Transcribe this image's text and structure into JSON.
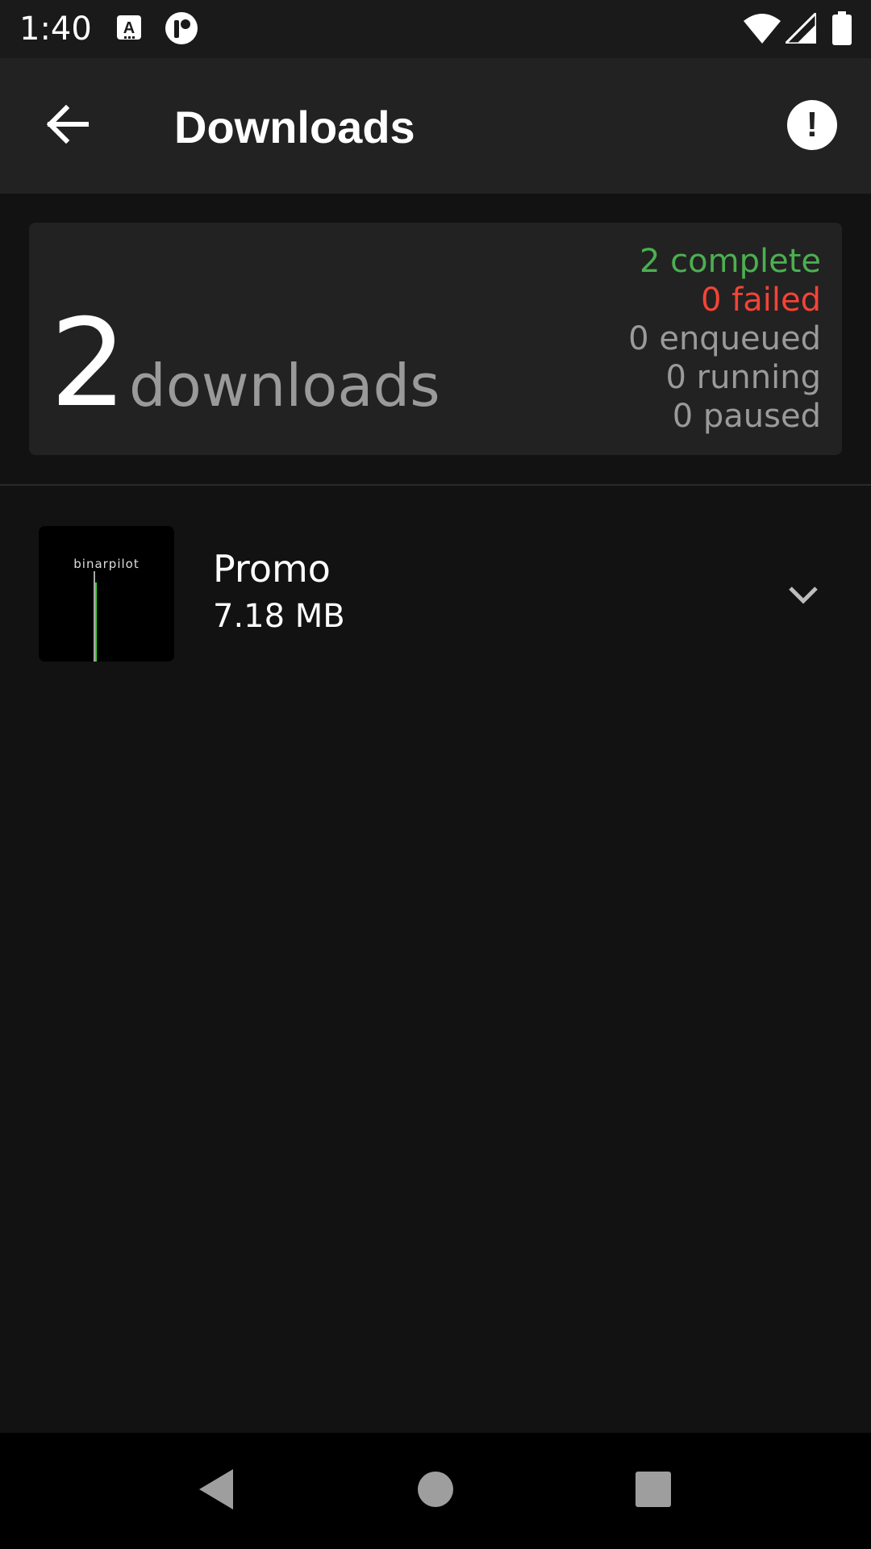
{
  "status_bar": {
    "time": "1:40",
    "left_icons": [
      "keyboard-a-icon",
      "circle-r-icon"
    ],
    "right_icons": [
      "wifi-icon",
      "signal-icon",
      "battery-icon"
    ]
  },
  "app_bar": {
    "back_icon": "arrow-left-icon",
    "title": "Downloads",
    "action_icon": "alert-info-icon",
    "action_symbol": "!"
  },
  "summary": {
    "count": "2",
    "label": "downloads",
    "stats": {
      "complete": "2 complete",
      "failed": "0 failed",
      "enqueued": "0 enqueued",
      "running": "0 running",
      "paused": "0 paused"
    }
  },
  "downloads": [
    {
      "title": "Promo",
      "size": "7.18 MB",
      "thumbnail_icon": "binarpilot-cover-art",
      "expand_icon": "chevron-down-icon"
    }
  ],
  "nav": {
    "back_icon": "nav-back-icon",
    "home_icon": "nav-home-icon",
    "recents_icon": "nav-recents-icon"
  },
  "colors": {
    "background": "#121212",
    "surface": "#222222",
    "complete": "#4caf50",
    "failed": "#f44336",
    "muted": "#9a9a9a",
    "accent_green": "#39d12a"
  }
}
